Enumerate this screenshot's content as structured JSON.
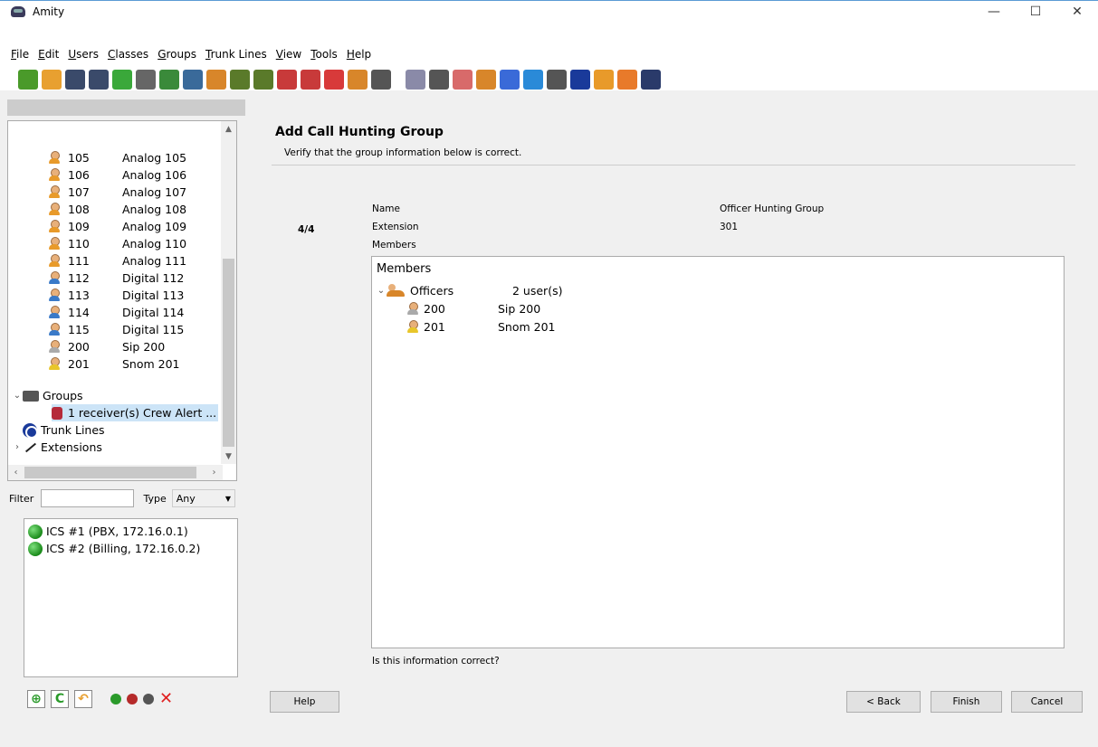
{
  "window": {
    "title": "Amity",
    "minimize": "—",
    "maximize": "☐",
    "close": "✕"
  },
  "menu": [
    {
      "mnemonic": "F",
      "rest": "ile"
    },
    {
      "mnemonic": "E",
      "rest": "dit"
    },
    {
      "mnemonic": "U",
      "rest": "sers"
    },
    {
      "mnemonic": "C",
      "rest": "lasses"
    },
    {
      "mnemonic": "G",
      "rest": "roups"
    },
    {
      "mnemonic": "T",
      "rest": "runk Lines"
    },
    {
      "mnemonic": "V",
      "rest": "iew"
    },
    {
      "mnemonic": "T",
      "rest": "ools"
    },
    {
      "mnemonic": "H",
      "rest": "elp"
    }
  ],
  "toolbar_icons": [
    "new-icon",
    "open-icon",
    "save-icon",
    "save-as-icon",
    "export-icon",
    "print-icon",
    "add-user-icon",
    "user-card-icon",
    "add-group-icon",
    "hunting-group-icon",
    "ring-group-icon",
    "speaker-icon",
    "speaker-2-icon",
    "alert-user-icon",
    "conference-icon",
    "phone-icon",
    "add-doc-icon",
    "gear-icon",
    "disc-icon",
    "user-settings-icon",
    "link-icon",
    "upload-icon",
    "tools-icon",
    "trunk-icon",
    "back-arrow-icon",
    "forward-arrow-icon",
    "server-icon"
  ],
  "toolbar_colors": [
    "#4a9a2a",
    "#e8a030",
    "#3a4a6a",
    "#3a4a6a",
    "#3aa83a",
    "#666666",
    "#3a8a3a",
    "#3a6a9a",
    "#d8862a",
    "#5a7a2a",
    "#5a7a2a",
    "#c83a3a",
    "#c83a3a",
    "#d83a3a",
    "#d8862a",
    "#555555",
    "#8a8aa8",
    "#555555",
    "#d86a6a",
    "#d8862a",
    "#3a6ad8",
    "#2a8ad8",
    "#555555",
    "#1a3a9a",
    "#e89a2a",
    "#e87a2a",
    "#2a3a6a"
  ],
  "tree": {
    "users": [
      {
        "ext": "105",
        "name": "Analog 105",
        "kind": "analog"
      },
      {
        "ext": "106",
        "name": "Analog 106",
        "kind": "analog"
      },
      {
        "ext": "107",
        "name": "Analog 107",
        "kind": "analog"
      },
      {
        "ext": "108",
        "name": "Analog 108",
        "kind": "analog"
      },
      {
        "ext": "109",
        "name": "Analog 109",
        "kind": "analog"
      },
      {
        "ext": "110",
        "name": "Analog 110",
        "kind": "analog"
      },
      {
        "ext": "111",
        "name": "Analog 111",
        "kind": "analog"
      },
      {
        "ext": "112",
        "name": "Digital 112",
        "kind": "digital"
      },
      {
        "ext": "113",
        "name": "Digital 113",
        "kind": "digital"
      },
      {
        "ext": "114",
        "name": "Digital 114",
        "kind": "digital"
      },
      {
        "ext": "115",
        "name": "Digital 115",
        "kind": "digital"
      },
      {
        "ext": "200",
        "name": "Sip 200",
        "kind": "sip"
      },
      {
        "ext": "201",
        "name": "Snom 201",
        "kind": "snom"
      }
    ],
    "groups_label": "Groups",
    "crew_alert": "1 receiver(s) Crew Alert ...",
    "trunk_lines_label": "Trunk Lines",
    "extensions_label": "Extensions"
  },
  "filter": {
    "label": "Filter",
    "value": "",
    "type_label": "Type",
    "type_value": "Any"
  },
  "servers": [
    "ICS #1 (PBX, 172.16.0.1)",
    "ICS #2 (Billing, 172.16.0.2)"
  ],
  "bottom_status_colors": [
    "#2a9a2a",
    "#b52a2a",
    "#555555"
  ],
  "wizard": {
    "title": "Add Call Hunting Group",
    "subtitle": "Verify that the group information below is correct.",
    "step": "4/4",
    "fields": [
      {
        "label": "Name",
        "value": "Officer Hunting Group"
      },
      {
        "label": "Extension",
        "value": "301"
      },
      {
        "label": "Members",
        "value": ""
      }
    ],
    "members_box": {
      "title": "Members",
      "group": {
        "name": "Officers",
        "count": "2 user(s)"
      },
      "users": [
        {
          "ext": "200",
          "name": "Sip 200",
          "kind": "sip"
        },
        {
          "ext": "201",
          "name": "Snom 201",
          "kind": "snom"
        }
      ]
    },
    "question": "Is this information correct?",
    "buttons": {
      "help": "Help",
      "back": "< Back",
      "finish": "Finish",
      "cancel": "Cancel"
    }
  }
}
